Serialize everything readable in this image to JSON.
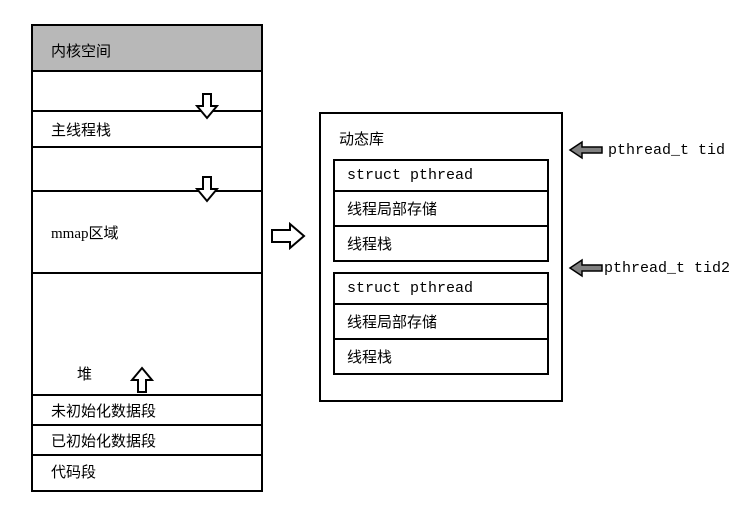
{
  "left": {
    "kernel": "内核空间",
    "main_stack": "主线程栈",
    "mmap": "mmap区域",
    "heap": "堆",
    "bss": "未初始化数据段",
    "data": "已初始化数据段",
    "text": "代码段"
  },
  "right": {
    "title": "动态库",
    "thread1": {
      "struct": "struct pthread",
      "tls": "线程局部存储",
      "stack": "线程栈"
    },
    "thread2": {
      "struct": "struct pthread",
      "tls": "线程局部存储",
      "stack": "线程栈"
    }
  },
  "labels": {
    "tid1": "pthread_t tid",
    "tid2": "pthread_t tid2"
  }
}
